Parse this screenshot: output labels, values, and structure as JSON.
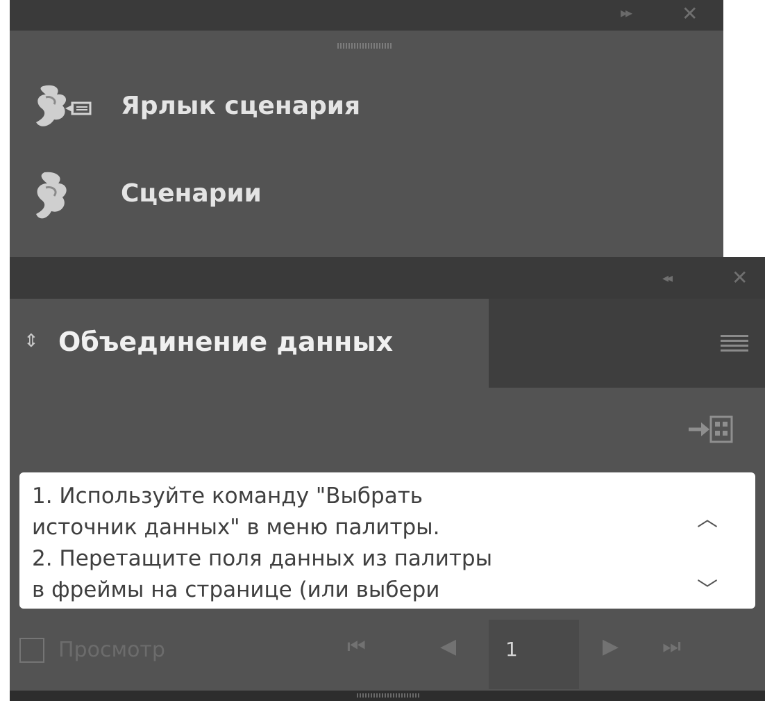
{
  "scripts_panel": {
    "collapse_icon": "double-chevron-right-icon",
    "close_icon": "close-icon",
    "items": [
      {
        "label": "Ярлык сценария",
        "icon": "script-shortcut-icon"
      },
      {
        "label": "Сценарии",
        "icon": "script-icon"
      }
    ]
  },
  "data_merge_panel": {
    "collapse_icon": "double-chevron-left-icon",
    "close_icon": "close-icon",
    "tab_title": "Объединение данных",
    "menu_icon": "panel-menu-icon",
    "import_icon": "create-merged-document-icon",
    "instructions": "1. Используйте команду \"Выбрать\nисточник данных\" в меню палитры.\n2. Перетащите поля данных из палитры\nв фреймы на странице (или выбери",
    "preview_label": "Просмотр",
    "preview_checked": false,
    "page_number": "1",
    "colors": {
      "panel": "#535353",
      "titlebar": "#3a3a3a",
      "text": "#e4e4e4"
    }
  }
}
